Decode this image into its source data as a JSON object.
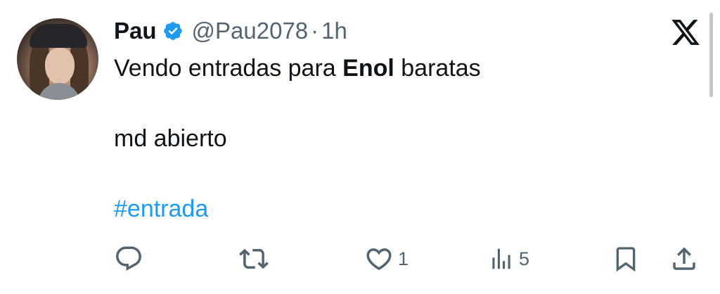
{
  "tweet": {
    "author_name": "Pau",
    "handle": "@Pau2078",
    "separator": "·",
    "time": "1h",
    "text_line1_before": "Vendo entradas para ",
    "text_line1_bold": "Enol",
    "text_line1_after": " baratas",
    "text_line2": "md abierto",
    "hashtag": "#entrada"
  },
  "actions": {
    "reply_icon": "reply-icon",
    "retweet_icon": "retweet-icon",
    "like_icon": "heart-icon",
    "like_count": "1",
    "views_icon": "views-icon",
    "views_count": "5",
    "bookmark_icon": "bookmark-icon",
    "share_icon": "share-icon"
  },
  "colors": {
    "verified": "#1d9bf0",
    "hashtag": "#1d9bf0",
    "secondary_text": "#536471",
    "primary_text": "#0f1419"
  }
}
